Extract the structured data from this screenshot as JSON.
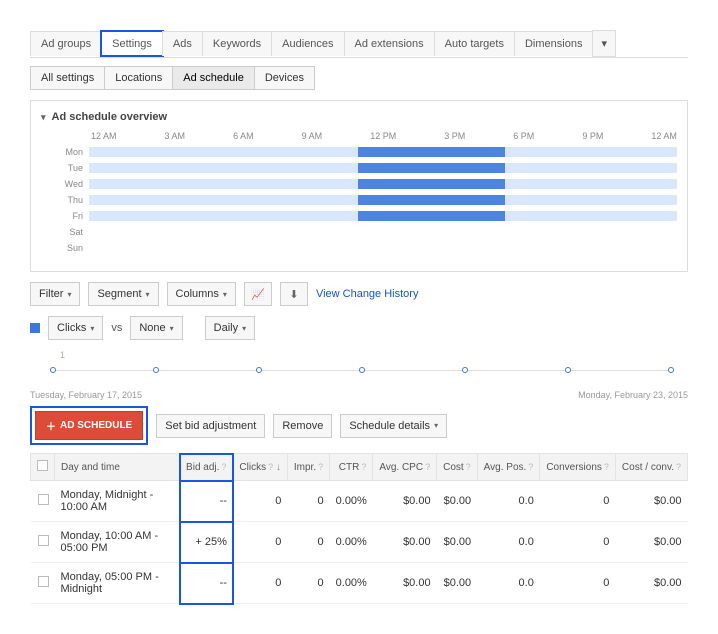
{
  "tabs": [
    "Ad groups",
    "Settings",
    "Ads",
    "Keywords",
    "Audiences",
    "Ad extensions",
    "Auto targets",
    "Dimensions"
  ],
  "subtabs": [
    "All settings",
    "Locations",
    "Ad schedule",
    "Devices"
  ],
  "panel_title": "Ad schedule overview",
  "hours": [
    "12 AM",
    "3 AM",
    "6 AM",
    "9 AM",
    "12 PM",
    "3 PM",
    "6 PM",
    "9 PM",
    "12 AM"
  ],
  "days": [
    "Mon",
    "Tue",
    "Wed",
    "Thu",
    "Fri",
    "Sat",
    "Sun"
  ],
  "schedule_rows": [
    {
      "day": "Mon",
      "fill_start": 45.8,
      "fill_end": 70.8,
      "empty": false
    },
    {
      "day": "Tue",
      "fill_start": 45.8,
      "fill_end": 70.8,
      "empty": false
    },
    {
      "day": "Wed",
      "fill_start": 45.8,
      "fill_end": 70.8,
      "empty": false
    },
    {
      "day": "Thu",
      "fill_start": 45.8,
      "fill_end": 70.8,
      "empty": false
    },
    {
      "day": "Fri",
      "fill_start": 45.8,
      "fill_end": 70.8,
      "empty": false
    },
    {
      "day": "Sat",
      "fill_start": 0,
      "fill_end": 0,
      "empty": true
    },
    {
      "day": "Sun",
      "fill_start": 0,
      "fill_end": 0,
      "empty": true
    }
  ],
  "toolbar": {
    "filter": "Filter",
    "segment": "Segment",
    "columns": "Columns",
    "view_history": "View Change History",
    "clicks": "Clicks",
    "none": "None",
    "daily": "Daily",
    "vs": "vs"
  },
  "timeline": {
    "scale": "1",
    "start": "Tuesday, February 17, 2015",
    "end": "Monday, February 23, 2015"
  },
  "actions": {
    "add_schedule": "AD SCHEDULE",
    "set_bid": "Set bid adjustment",
    "remove": "Remove",
    "details": "Schedule details"
  },
  "columns_h": [
    "Day and time",
    "Bid adj.",
    "Clicks",
    "Impr.",
    "CTR",
    "Avg. CPC",
    "Cost",
    "Avg. Pos.",
    "Conversions",
    "Cost / conv."
  ],
  "rows": [
    {
      "time": "Monday, Midnight - 10:00 AM",
      "bid": "--",
      "clicks": "0",
      "impr": "0",
      "ctr": "0.00%",
      "cpc": "$0.00",
      "cost": "$0.00",
      "pos": "0.0",
      "conv": "0",
      "costconv": "$0.00"
    },
    {
      "time": "Monday, 10:00 AM - 05:00 PM",
      "bid": "+ 25%",
      "clicks": "0",
      "impr": "0",
      "ctr": "0.00%",
      "cpc": "$0.00",
      "cost": "$0.00",
      "pos": "0.0",
      "conv": "0",
      "costconv": "$0.00"
    },
    {
      "time": "Monday, 05:00 PM - Midnight",
      "bid": "--",
      "clicks": "0",
      "impr": "0",
      "ctr": "0.00%",
      "cpc": "$0.00",
      "cost": "$0.00",
      "pos": "0.0",
      "conv": "0",
      "costconv": "$0.00"
    }
  ],
  "chart_data": {
    "type": "table",
    "note": "Weekday ad-schedule bars span roughly 11 AM–5 PM; weekends empty",
    "columns": [
      "Day and time",
      "Bid adj.",
      "Clicks",
      "Impr.",
      "CTR",
      "Avg. CPC",
      "Cost",
      "Avg. Pos.",
      "Conversions",
      "Cost / conv."
    ],
    "rows": [
      [
        "Monday, Midnight - 10:00 AM",
        "--",
        0,
        0,
        "0.00%",
        "$0.00",
        "$0.00",
        0.0,
        0,
        "$0.00"
      ],
      [
        "Monday, 10:00 AM - 05:00 PM",
        "+ 25%",
        0,
        0,
        "0.00%",
        "$0.00",
        "$0.00",
        0.0,
        0,
        "$0.00"
      ],
      [
        "Monday, 05:00 PM - Midnight",
        "--",
        0,
        0,
        "0.00%",
        "$0.00",
        "$0.00",
        0.0,
        0,
        "$0.00"
      ]
    ]
  }
}
